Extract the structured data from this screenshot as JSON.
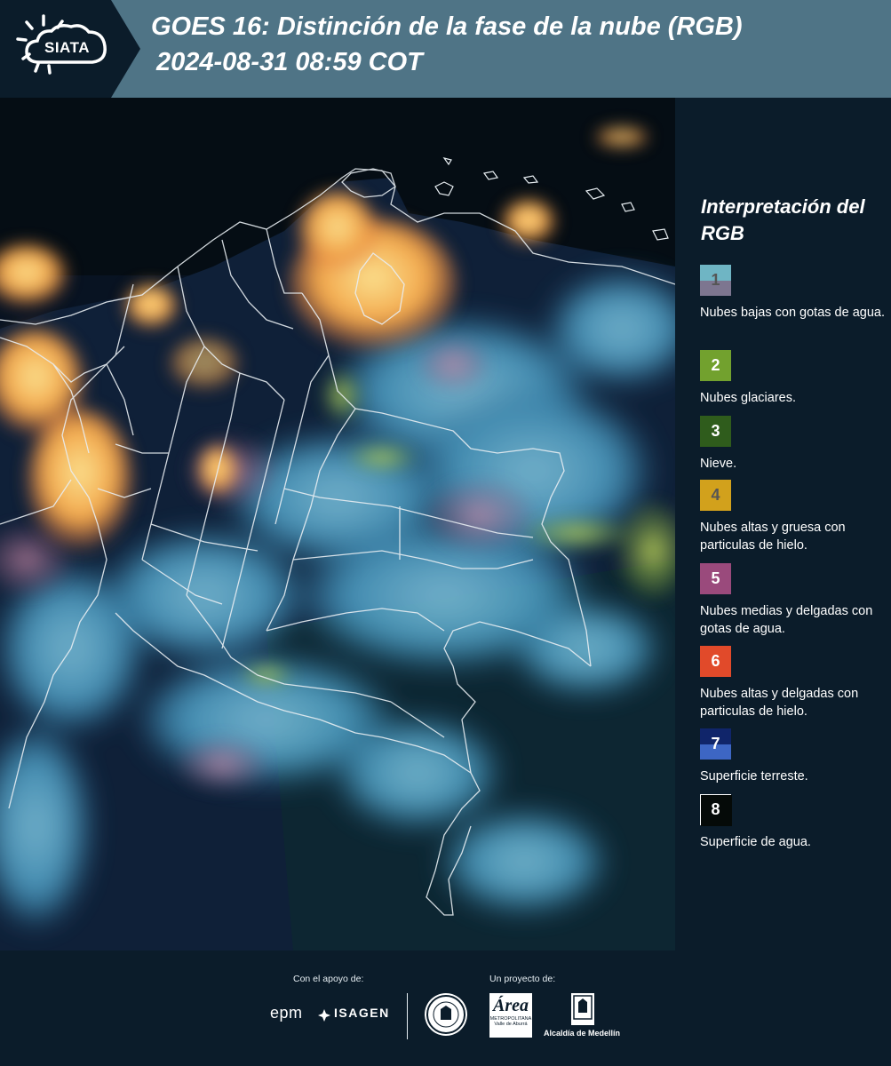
{
  "header": {
    "logo_text": "SIATA",
    "title_line_1": "GOES 16: Distinción de la fase de la nube (RGB)",
    "title_line_2": "2024-08-31 08:59 COT"
  },
  "legend": {
    "title": "Interpretación del RGB",
    "items": [
      {
        "number": "1",
        "label": "Nubes bajas con gotas de agua.",
        "color_top": "#6fb5c4",
        "color_bottom": "#7d7690",
        "num_color": "#555555"
      },
      {
        "number": "2",
        "label": "Nubes glaciares.",
        "color_top": "#72a12e",
        "color_bottom": "#72a12e",
        "num_color": "#ffffff"
      },
      {
        "number": "3",
        "label": "Nieve.",
        "color_top": "#2f5c1c",
        "color_bottom": "#2f5c1c",
        "num_color": "#ffffff"
      },
      {
        "number": "4",
        "label": "Nubes altas y gruesa con particulas de hielo.",
        "color_top": "#d2a11c",
        "color_bottom": "#d2a11c",
        "num_color": "#555555"
      },
      {
        "number": "5",
        "label": "Nubes medias y delgadas con gotas de agua.",
        "color_top": "#9a4a7c",
        "color_bottom": "#9a4a7c",
        "num_color": "#ffffff"
      },
      {
        "number": "6",
        "label": "Nubes altas y delgadas con particulas de hielo.",
        "color_top": "#e14a2a",
        "color_bottom": "#e14a2a",
        "num_color": "#ffffff"
      },
      {
        "number": "7",
        "label": "Superficie terreste.",
        "color_top": "#10256a",
        "color_bottom": "#3d66c4",
        "num_color": "#ffffff"
      },
      {
        "number": "8",
        "label": "Superficie de agua.",
        "color_top": "#050a08",
        "color_bottom": "#050a08",
        "num_color": "#ffffff"
      }
    ]
  },
  "footer": {
    "support_caption": "Con el apoyo de:",
    "project_caption": "Un proyecto de:",
    "epm": "epm",
    "isagen": "ISAGEN",
    "area_big": "Área",
    "area_small_1": "METROPOLITANA",
    "area_small_2": "Valle de Aburrá",
    "alcaldia": "Alcaldía de Medellín"
  },
  "colors": {
    "header_bg": "#4f7486",
    "panel_bg": "#0b1c2a",
    "cloud_orange": "#f0a84a",
    "cloud_cyan": "#5fb3d6",
    "land_dark": "#0f2038"
  }
}
